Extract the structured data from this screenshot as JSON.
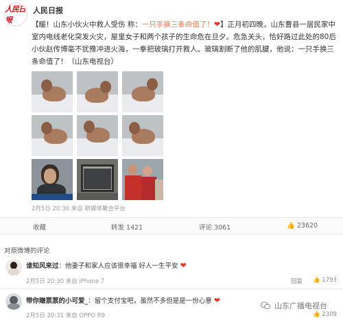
{
  "post": {
    "author": "人民日报",
    "logo_text": "人民日报",
    "text_prefix": "【暖！山东小伙火中救人受伤 称：",
    "text_quote": "一只手换三条命值了！",
    "text_body": "】正月初四晚，山东曹县一居民家中室内电线老化突发火灾，屋里女子和两个孩子的生命危在旦夕。危急关头，恰好路过此处的80后小伙赵传博毫不犹豫冲进火海，一拳把玻璃打开救人。玻璃割断了他的肌腱，他说：一只手换三条命值了！（山东电视台）",
    "meta": "2月5日 20:30 来自 新媒体聚合平台",
    "images": [
      "hospital-photo",
      "hospital-photo",
      "hospital-photo",
      "hospital-photo",
      "hospital-photo",
      "hospital-photo",
      "news-clip-photo",
      "burned-window-photo",
      "family-photo"
    ]
  },
  "actions": {
    "favorite": "收藏",
    "repost": "转发 1421",
    "comment": "评论 3061",
    "like": "23620"
  },
  "comments_title": "对原微博的评论",
  "comments": [
    {
      "user": "谁知风来过",
      "text": "：他妻子和家人应该很幸福 好人一生平安",
      "meta": "2月5日 20:30 来自 iPhone 7",
      "reply": "回复",
      "likes": "1793"
    },
    {
      "user": "带你赚票票的小可爱_",
      "text": "：留个支付宝吧，虽然不多但是是一份心意",
      "meta": "2月5日 20:31 来自 OPPO R9",
      "reply": "回复",
      "likes": "2309"
    }
  ],
  "watermark": "山东广播电视台",
  "icons": {
    "heart": "heart-emoji-icon",
    "like": "thumb-up-icon",
    "wechat": "wechat-icon"
  },
  "colors": {
    "link": "#eb7350",
    "heart": "#e8362e",
    "logo": "#c8161d"
  }
}
